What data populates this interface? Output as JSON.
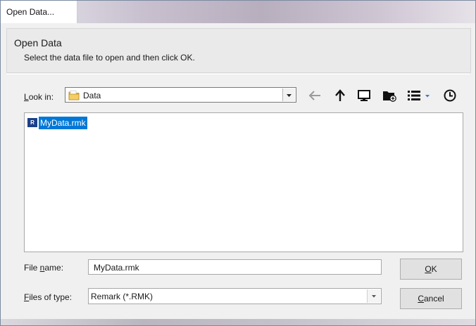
{
  "window": {
    "title": "Open Data..."
  },
  "header": {
    "title": "Open Data",
    "subtitle": "Select the data file to open and then click OK."
  },
  "look_in": {
    "label_access": "L",
    "label_rest": "ook in:",
    "value": "Data"
  },
  "toolbar": {
    "icons": [
      "back-arrow-icon",
      "up-arrow-icon",
      "desktop-icon",
      "new-folder-icon",
      "view-menu-icon",
      "recent-places-icon"
    ]
  },
  "files": [
    {
      "icon_text": "R",
      "name": "MyData.rmk",
      "selected": true
    }
  ],
  "file_name": {
    "label_before": "File ",
    "label_access": "n",
    "label_after": "ame:",
    "value": "MyData.rmk"
  },
  "file_type": {
    "label_access": "F",
    "label_rest": "iles of type:",
    "value": "Remark (*.RMK)"
  },
  "buttons": {
    "ok_access": "O",
    "ok_rest": "K",
    "cancel_access": "C",
    "cancel_rest": "ancel"
  },
  "colors": {
    "selection": "#0078d7",
    "file_icon": "#1b3f8a"
  }
}
